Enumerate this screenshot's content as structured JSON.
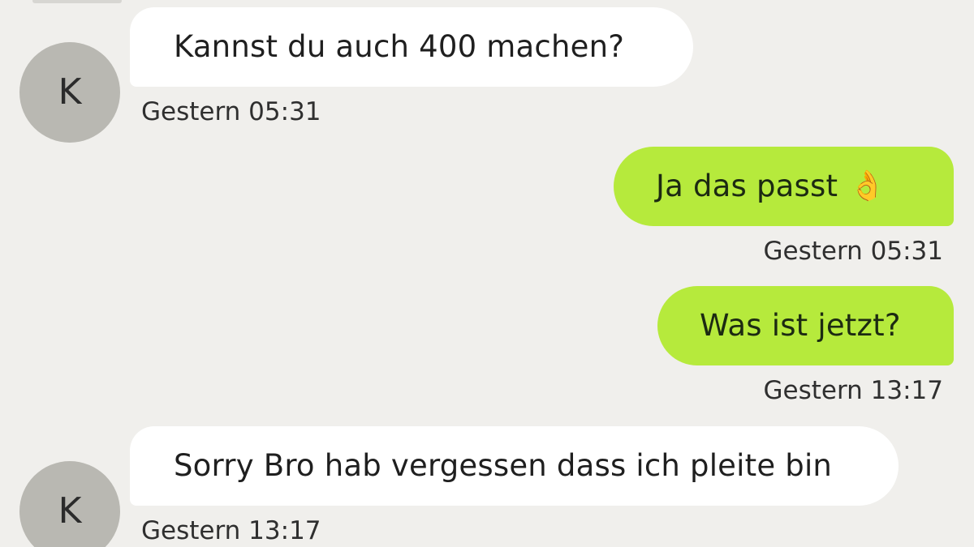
{
  "conversation": {
    "contact_initial": "K",
    "messages": [
      {
        "direction": "incoming",
        "text": "Kannst du auch 400 machen?",
        "time": "Gestern 05:31"
      },
      {
        "direction": "outgoing",
        "text": "Ja das passt",
        "emoji": "👌",
        "time": "Gestern 05:31"
      },
      {
        "direction": "outgoing",
        "text": "Was ist jetzt?",
        "time": "Gestern 13:17"
      },
      {
        "direction": "incoming",
        "text": "Sorry Bro hab vergessen dass ich pleite bin",
        "time": "Gestern 13:17"
      }
    ]
  },
  "colors": {
    "background": "#f0efec",
    "incoming_bubble": "#ffffff",
    "outgoing_bubble": "#b6ea3c",
    "avatar": "#b9b8b2"
  }
}
